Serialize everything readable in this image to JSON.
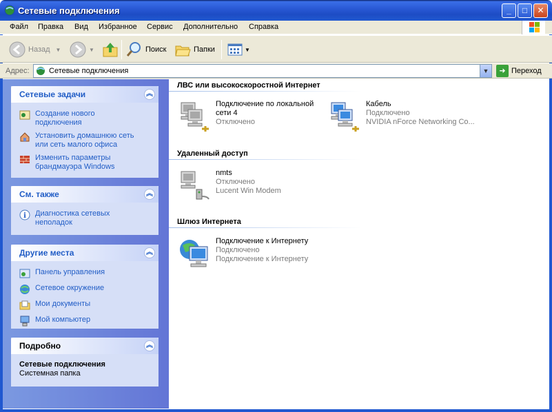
{
  "window": {
    "title": "Сетевые подключения",
    "icon": "network-connections-icon"
  },
  "menu": [
    "Файл",
    "Правка",
    "Вид",
    "Избранное",
    "Сервис",
    "Дополнительно",
    "Справка"
  ],
  "toolbar": {
    "back_label": "Назад",
    "search_label": "Поиск",
    "folders_label": "Папки"
  },
  "address": {
    "label": "Адрес:",
    "value": "Сетевые подключения",
    "go_label": "Переход"
  },
  "sidebar": {
    "network_tasks": {
      "title": "Сетевые задачи",
      "items": [
        {
          "label": "Создание нового\nподключения",
          "icon": "new-connection-icon"
        },
        {
          "label": "Установить домашнюю сеть\nили сеть малого офиса",
          "icon": "home-network-icon"
        },
        {
          "label": "Изменить параметры\nбрандмауэра Windows",
          "icon": "firewall-icon"
        }
      ]
    },
    "see_also": {
      "title": "См. также",
      "items": [
        {
          "label": "Диагностика сетевых\nнеполадок",
          "icon": "info-icon"
        }
      ]
    },
    "other_places": {
      "title": "Другие места",
      "items": [
        {
          "label": "Панель управления",
          "icon": "control-panel-icon"
        },
        {
          "label": "Сетевое окружение",
          "icon": "network-places-icon"
        },
        {
          "label": "Мои документы",
          "icon": "my-documents-icon"
        },
        {
          "label": "Мой компьютер",
          "icon": "my-computer-icon"
        }
      ]
    },
    "details": {
      "title": "Подробно",
      "name": "Сетевые подключения",
      "sub": "Системная папка"
    }
  },
  "groups": {
    "lan": {
      "title": "ЛВС или высокоскоростной Интернет",
      "items": [
        {
          "name": "Подключение по локальной\nсети 4",
          "status": "Отключено",
          "device": ""
        },
        {
          "name": "Кабель",
          "status": "Подключено",
          "device": "NVIDIA nForce Networking Co..."
        }
      ]
    },
    "dialup": {
      "title": "Удаленный доступ",
      "items": [
        {
          "name": "nmts",
          "status": "Отключено",
          "device": "Lucent Win Modem"
        }
      ]
    },
    "gateway": {
      "title": "Шлюз Интернета",
      "items": [
        {
          "name": "Подключение к Интернету",
          "status": "Подключено",
          "device": "Подключение к Интернету"
        }
      ]
    }
  },
  "colors": {
    "titlebar": "#2058d0",
    "sidebar": "#6d86dc",
    "link": "#215dc6"
  }
}
